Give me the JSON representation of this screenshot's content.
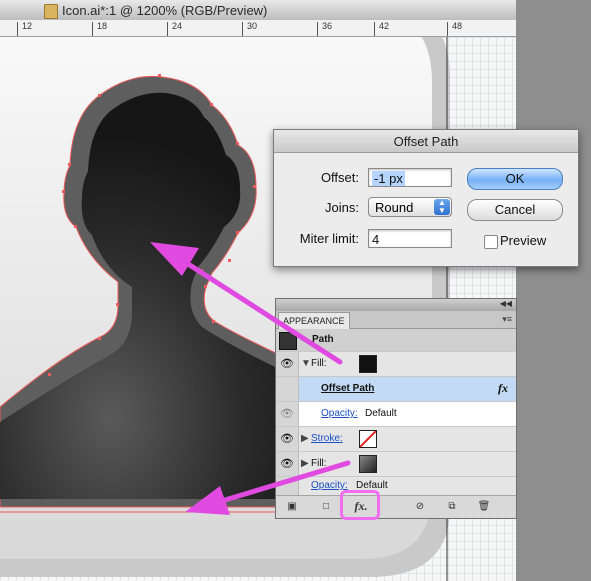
{
  "window": {
    "title": "Icon.ai*:1 @ 1200% (RGB/Preview)"
  },
  "ruler": {
    "ticks": [
      "12",
      "18",
      "24",
      "30",
      "36",
      "42",
      "48"
    ]
  },
  "offset_dialog": {
    "title": "Offset Path",
    "offset_label": "Offset:",
    "offset_value": "-1 px",
    "joins_label": "Joins:",
    "joins_value": "Round",
    "miter_label": "Miter limit:",
    "miter_value": "4",
    "ok_label": "OK",
    "cancel_label": "Cancel",
    "preview_label": "Preview",
    "preview_checked": false
  },
  "appearance_panel": {
    "tab_label": "APPEARANCE",
    "object_label": "Path",
    "rows": [
      {
        "label": "Fill:",
        "swatch": "#111111"
      },
      {
        "label": "Offset Path",
        "fx": "fx"
      },
      {
        "label": "Opacity:",
        "value": "Default"
      },
      {
        "label": "Stroke:",
        "swatch": "none"
      },
      {
        "label": "Fill:",
        "swatch": "gradient"
      },
      {
        "label": "Opacity:",
        "value": "Default"
      }
    ],
    "footer_fx": "fx."
  },
  "colors": {
    "annotation_arrow": "#e04ae0",
    "selection_path": "#f05a5a",
    "ok_button": "#76b1f5"
  }
}
